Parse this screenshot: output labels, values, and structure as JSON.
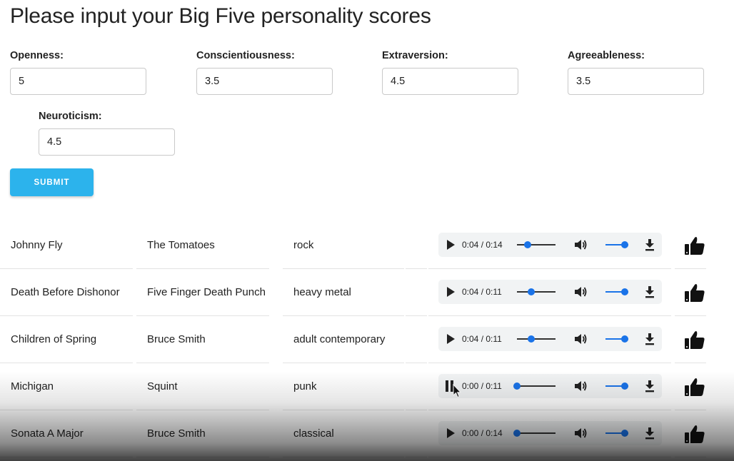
{
  "page": {
    "title": "Please input your Big Five personality scores"
  },
  "form": {
    "openness": {
      "label": "Openness:",
      "value": "5"
    },
    "conscientiousness": {
      "label": "Conscientiousness:",
      "value": "3.5"
    },
    "extraversion": {
      "label": "Extraversion:",
      "value": "4.5"
    },
    "agreeableness": {
      "label": "Agreeableness:",
      "value": "3.5"
    },
    "neuroticism": {
      "label": "Neuroticism:",
      "value": "4.5"
    },
    "submit_label": "SUBMIT"
  },
  "songs": [
    {
      "title": "Johnny Fly",
      "artist": "The Tomatoes",
      "genre": "rock",
      "time": "0:04 / 0:14",
      "progress": 0.286,
      "playing": false,
      "volume": 1.0
    },
    {
      "title": "Death Before Dishonor",
      "artist": "Five Finger Death Punch",
      "genre": "heavy metal",
      "time": "0:04 / 0:11",
      "progress": 0.364,
      "playing": false,
      "volume": 1.0
    },
    {
      "title": "Children of Spring",
      "artist": "Bruce Smith",
      "genre": "adult contemporary",
      "time": "0:04 / 0:11",
      "progress": 0.364,
      "playing": false,
      "volume": 1.0
    },
    {
      "title": "Michigan",
      "artist": "Squint",
      "genre": "punk",
      "time": "0:00 / 0:11",
      "progress": 0,
      "playing": true,
      "volume": 1.0
    },
    {
      "title": "Sonata A Major",
      "artist": "Bruce Smith",
      "genre": "classical",
      "time": "0:00 / 0:14",
      "progress": 0,
      "playing": false,
      "volume": 1.0
    }
  ],
  "icons": {
    "play": "play-icon",
    "pause": "pause-icon",
    "volume": "volume-icon",
    "download": "download-icon",
    "like": "thumbs-up-icon",
    "cursor": "mouse-pointer-icon"
  },
  "colors": {
    "submit": "#2cb3ec",
    "slider": "#1a73e8",
    "player_bg": "#f1f3f4"
  }
}
